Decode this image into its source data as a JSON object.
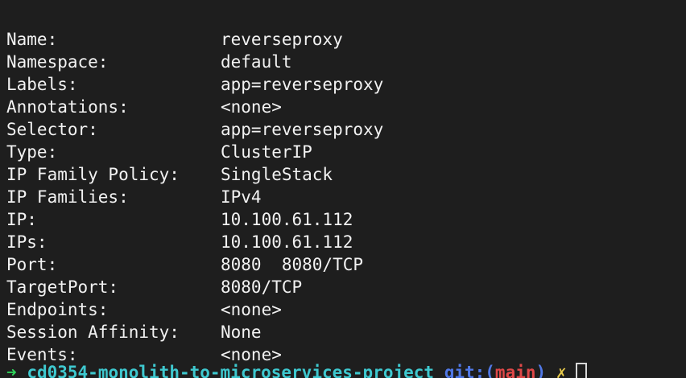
{
  "output": [
    {
      "key": "Name:",
      "value": "reverseproxy"
    },
    {
      "key": "Namespace:",
      "value": "default"
    },
    {
      "key": "Labels:",
      "value": "app=reverseproxy"
    },
    {
      "key": "Annotations:",
      "value": "<none>"
    },
    {
      "key": "Selector:",
      "value": "app=reverseproxy"
    },
    {
      "key": "Type:",
      "value": "ClusterIP"
    },
    {
      "key": "IP Family Policy:",
      "value": "SingleStack"
    },
    {
      "key": "IP Families:",
      "value": "IPv4"
    },
    {
      "key": "IP:",
      "value": "10.100.61.112"
    },
    {
      "key": "IPs:",
      "value": "10.100.61.112"
    },
    {
      "key": "Port:",
      "value": "8080  8080/TCP"
    },
    {
      "key": "TargetPort:",
      "value": "8080/TCP"
    },
    {
      "key": "Endpoints:",
      "value": "<none>"
    },
    {
      "key": "Session Affinity:",
      "value": "None"
    },
    {
      "key": "Events:",
      "value": "<none>"
    }
  ],
  "prompt": {
    "arrow": "➜",
    "directory": "cd0354-monolith-to-microservices-project",
    "git_label": "git:(",
    "branch": "main",
    "git_close": ")",
    "dirty_marker": "✗"
  },
  "colors": {
    "background": "#1e1e1e",
    "text": "#f2f2f2",
    "arrow": "#2fd35a",
    "directory": "#3ec8cf",
    "git": "#5078e6",
    "branch": "#e04848",
    "dirty": "#e6c94a"
  }
}
